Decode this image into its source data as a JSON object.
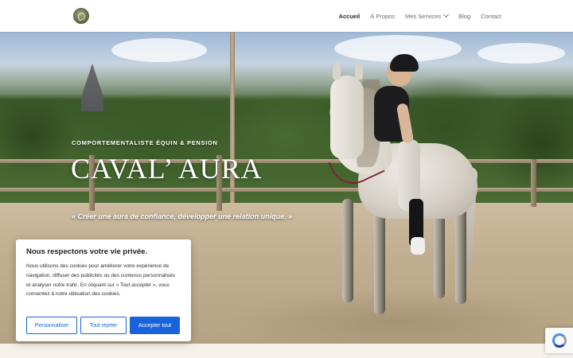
{
  "header": {
    "nav": [
      {
        "label": "Accueil",
        "active": true
      },
      {
        "label": "À Propos",
        "active": false
      },
      {
        "label": "Mes Services",
        "active": false,
        "has_dropdown": true
      },
      {
        "label": "Blog",
        "active": false
      },
      {
        "label": "Contact",
        "active": false
      }
    ]
  },
  "hero": {
    "kicker": "COMPORTEMENTALISTE ÉQUIN & PENSION",
    "title": "CAVAL’ AURA",
    "tagline": "« Créer une aura de confiance, développer une relation unique. »"
  },
  "cookie_banner": {
    "title": "Nous respectons votre vie privée.",
    "text": "Nous utilisons des cookies pour améliorer votre expérience de navigation, diffuser des publicités ou des contenus personnalisés et analyser notre trafic. En cliquant sur « Tout accepter », vous consentez à notre utilisation des cookies.",
    "customize_label": "Personnaliser",
    "reject_label": "Tout rejeter",
    "accept_label": "Accepter tout"
  },
  "colors": {
    "accent": "#1863dc",
    "header_bg": "#ffffff",
    "hero_text": "#ffffff"
  },
  "icons": {
    "logo": "horse-logo-icon",
    "dropdown": "chevron-down-icon",
    "recaptcha": "recaptcha-icon"
  }
}
